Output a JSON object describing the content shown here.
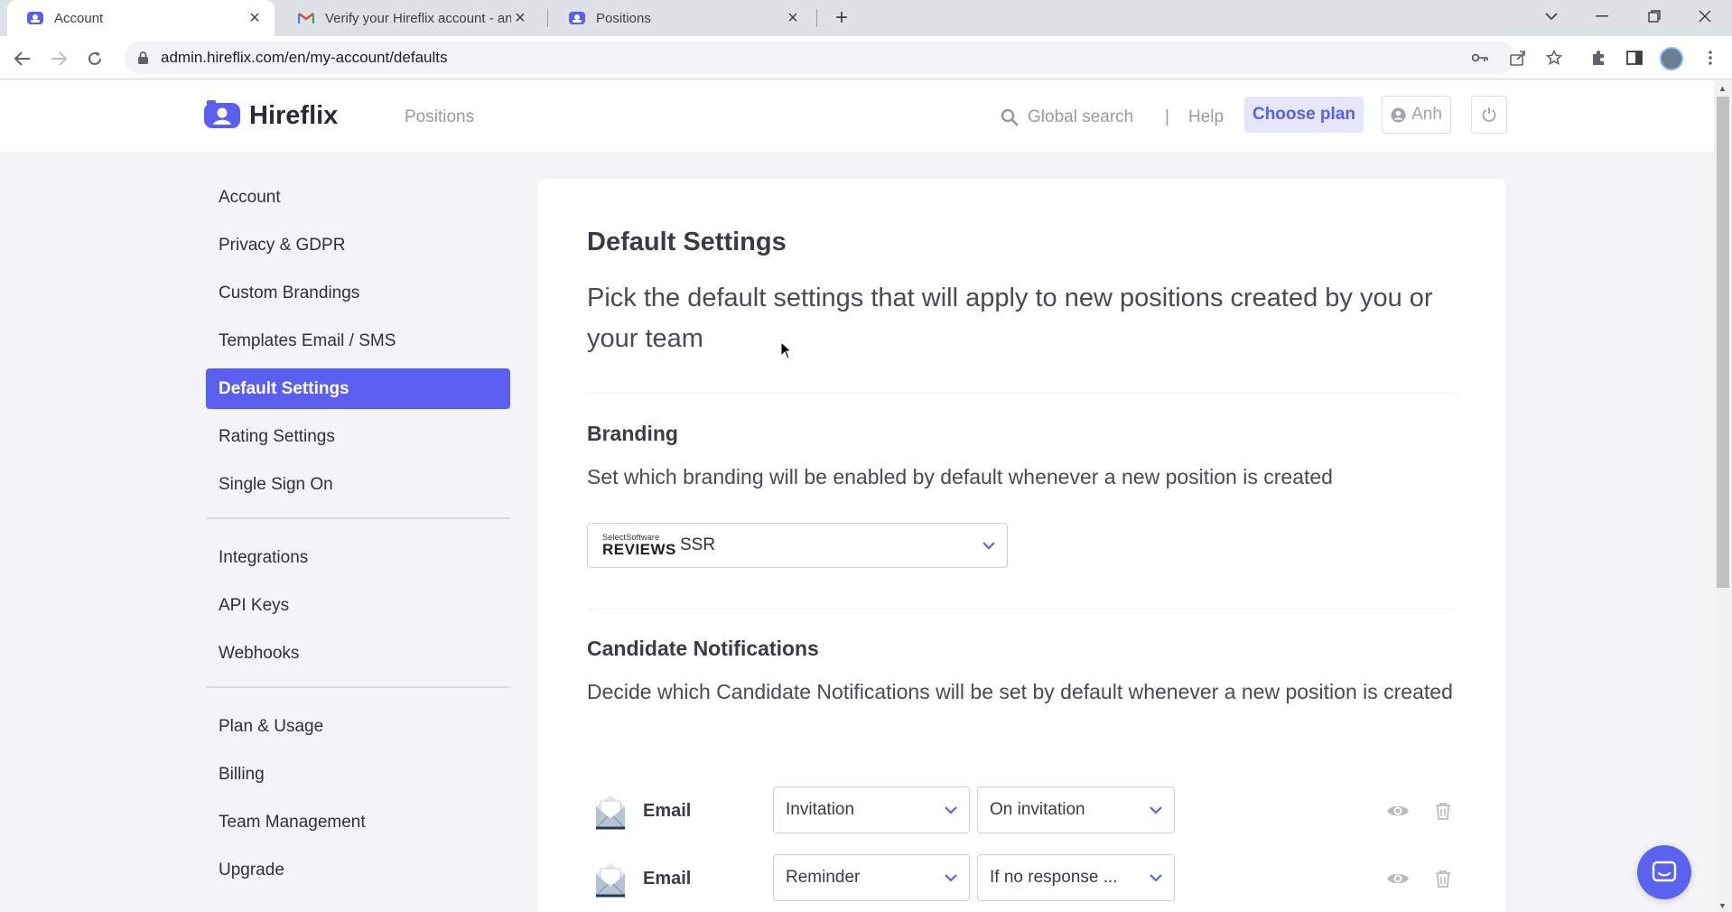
{
  "browser": {
    "tabs": [
      {
        "title": "Account",
        "active": true
      },
      {
        "title": "Verify your Hireflix account - anh",
        "active": false
      },
      {
        "title": "Positions",
        "active": false
      }
    ],
    "url": "admin.hireflix.com/en/my-account/defaults"
  },
  "header": {
    "brand": "Hireflix",
    "nav_positions": "Positions",
    "global_search": "Global search",
    "divider": "|",
    "help": "Help",
    "choose_plan": "Choose plan",
    "user": "Anh"
  },
  "sidebar": {
    "group1": [
      "Account",
      "Privacy & GDPR",
      "Custom Brandings",
      "Templates Email / SMS",
      "Default Settings",
      "Rating Settings",
      "Single Sign On"
    ],
    "group2": [
      "Integrations",
      "API Keys",
      "Webhooks"
    ],
    "group3": [
      "Plan & Usage",
      "Billing",
      "Team Management",
      "Upgrade"
    ],
    "active": "Default Settings"
  },
  "main": {
    "title": "Default Settings",
    "intro": "Pick the default settings that will apply to new positions created by you or your team",
    "branding": {
      "title": "Branding",
      "description": "Set which branding will be enabled by default whenever a new position is created",
      "logo_small": "SelectSoftware",
      "logo_big": "REVIEWS",
      "selected": "SSR"
    },
    "notifications": {
      "title": "Candidate Notifications",
      "description": "Decide which Candidate Notifications will be set by default whenever a new position is created",
      "rows": [
        {
          "channel": "Email",
          "type": "Invitation",
          "trigger": "On invitation"
        },
        {
          "channel": "Email",
          "type": "Reminder",
          "trigger": "If no response ..."
        }
      ]
    }
  },
  "colors": {
    "accent": "#5b5ff0",
    "choose_plan_bg": "#e6e7fd",
    "choose_plan_text": "#5b5fe8"
  }
}
